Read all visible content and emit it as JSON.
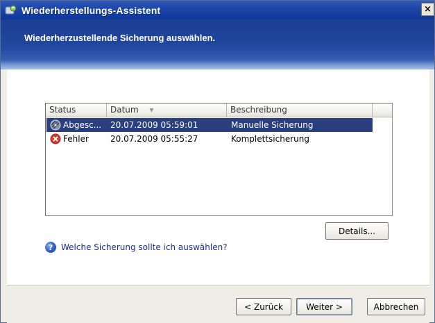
{
  "window": {
    "title": "Wiederherstellungs-Assistent",
    "close_label": "×"
  },
  "banner": {
    "title": "Wiederherzustellende Sicherung auswählen."
  },
  "list": {
    "columns": [
      "Status",
      "Datum",
      "Beschreibung"
    ],
    "sort_column": "Datum",
    "rows": [
      {
        "status": "Abgesc...",
        "status_icon": "archive-disk-icon",
        "date": "20.07.2009 05:59:01",
        "description": "Manuelle Sicherung",
        "selected": true
      },
      {
        "status": "Fehler",
        "status_icon": "error-icon",
        "date": "20.07.2009 05:55:27",
        "description": "Komplettsicherung",
        "selected": false
      }
    ]
  },
  "details_button": "Details...",
  "help": {
    "icon": "help-icon",
    "label": "Welche Sicherung sollte ich auswählen?"
  },
  "footer": {
    "back_label": "< Zurück",
    "next_label": "Weiter >",
    "cancel_label": "Abbrechen"
  },
  "colors": {
    "title_bar": "#1c46a6",
    "selection": "#2a3f7e",
    "link": "#1a2d9c",
    "error": "#d93a2e"
  }
}
